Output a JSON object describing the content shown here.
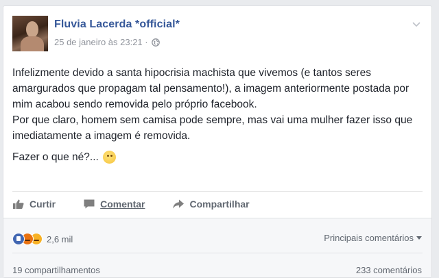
{
  "post": {
    "author": "Fluvia Lacerda *official*",
    "timestamp": "25 de janeiro às 23:21 ·",
    "privacy_icon": "globe-icon",
    "menu_icon": "chevron-down-icon",
    "paragraph1": "Infelizmente devido a santa hipocrisia machista que vivemos (e tantos seres amargurados que propagam tal pensamento!), a imagem anteriormente postada por mim acabou sendo removida pelo próprio facebook.",
    "paragraph2": "Por que claro, homem sem camisa pode sempre, mas vai uma mulher fazer isso que imediatamente a imagem é removida.",
    "paragraph3": "Fazer o que né?...",
    "emoji_icon": "rolling-eyes-emoji"
  },
  "actions": {
    "like_label": "Curtir",
    "comment_label": "Comentar",
    "share_label": "Compartilhar"
  },
  "footer": {
    "reaction_count": "2,6 mil",
    "reaction_icons": [
      "like-reaction-icon",
      "angry-reaction-icon",
      "sad-reaction-icon"
    ],
    "sort_label": "Principais comentários",
    "shares": "19 compartilhamentos",
    "comments": "233 comentários"
  },
  "colors": {
    "link_blue": "#365899",
    "muted": "#90949c",
    "like_blue": "#4267b2"
  }
}
